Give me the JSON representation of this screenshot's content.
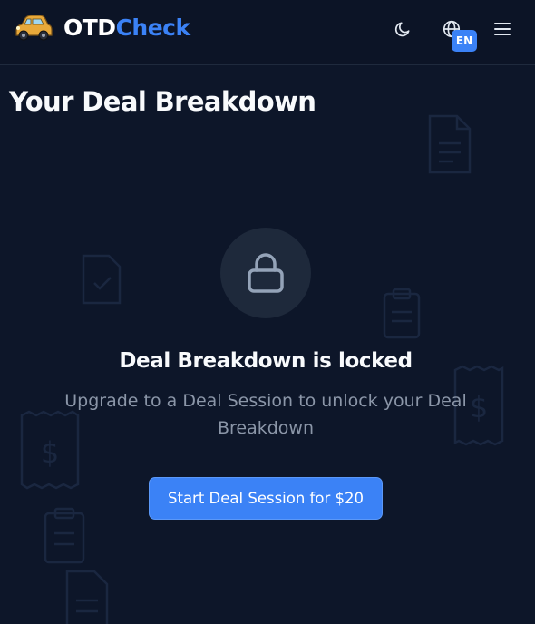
{
  "header": {
    "brand_part1": "OTD",
    "brand_part2": "Check",
    "language_badge": "EN",
    "icons": {
      "logo": "car-logo-icon",
      "theme": "moon-icon",
      "language": "globe-icon",
      "menu": "hamburger-menu-icon"
    }
  },
  "page": {
    "title": "Your Deal Breakdown"
  },
  "locked_panel": {
    "icon": "lock-icon",
    "title": "Deal Breakdown is locked",
    "description": "Upgrade to a Deal Session to unlock your Deal Breakdown",
    "cta_label": "Start Deal Session for $20"
  },
  "colors": {
    "background": "#0d1629",
    "header_background": "#0c1426",
    "accent": "#3b82f6",
    "text_primary": "#f8fafc",
    "text_muted": "#8b96a8",
    "lock_circle": "#1e293b"
  }
}
